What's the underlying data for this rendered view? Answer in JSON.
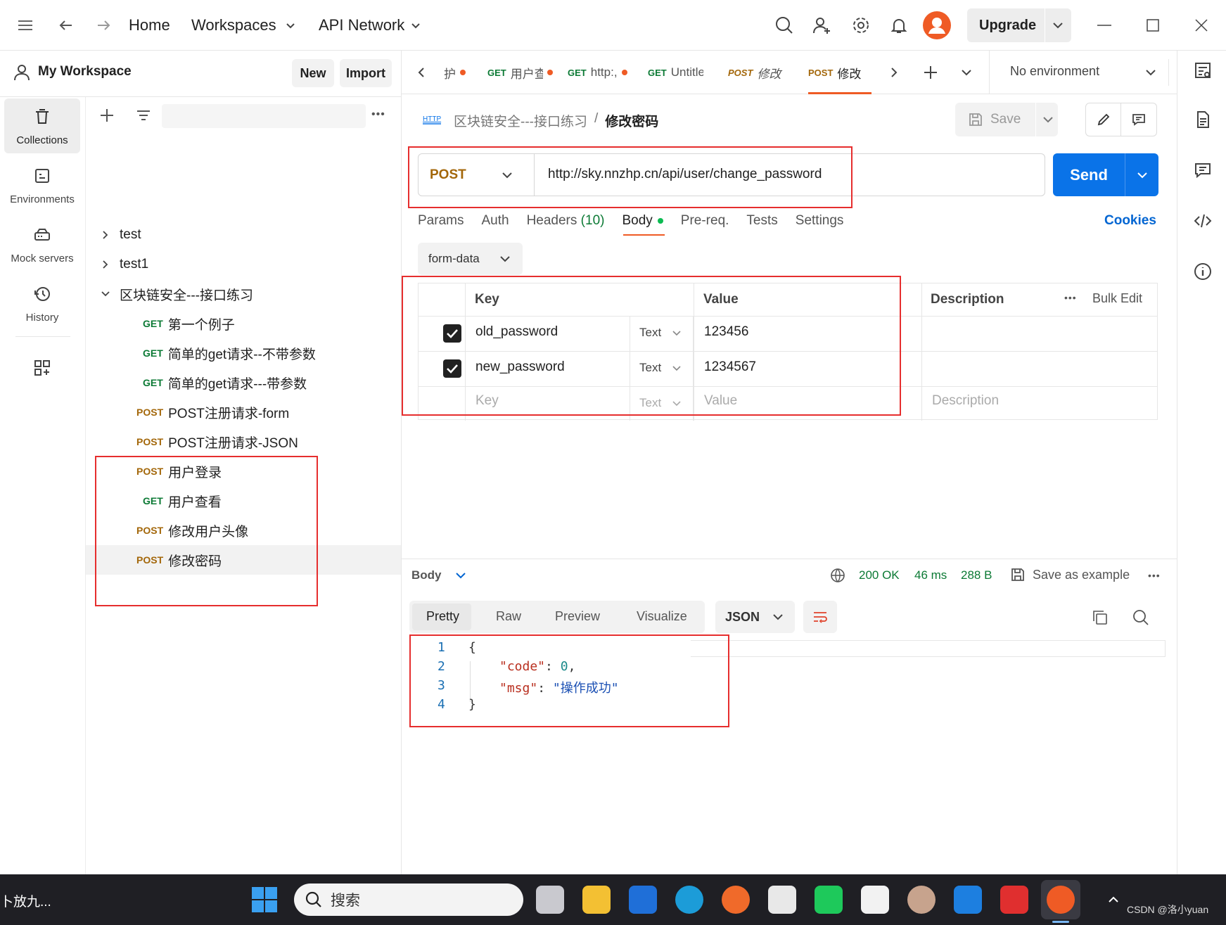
{
  "titlebar": {
    "nav_home": "Home",
    "nav_workspaces": "Workspaces",
    "nav_api_network": "API Network",
    "upgrade_label": "Upgrade"
  },
  "workspace": {
    "name": "My Workspace",
    "new_label": "New",
    "import_label": "Import"
  },
  "leftnav": {
    "items": [
      {
        "label": "Collections"
      },
      {
        "label": "Environments"
      },
      {
        "label": "Mock servers"
      },
      {
        "label": "History"
      }
    ]
  },
  "tree": {
    "items": [
      {
        "method": "",
        "label": "test"
      },
      {
        "method": "",
        "label": "test1"
      },
      {
        "method": "",
        "label": "区块链安全---接口练习"
      },
      {
        "method": "GET",
        "label": "第一个例子"
      },
      {
        "method": "GET",
        "label": "简单的get请求--不带参数"
      },
      {
        "method": "GET",
        "label": "简单的get请求---带参数"
      },
      {
        "method": "POST",
        "label": "POST注册请求-form"
      },
      {
        "method": "POST",
        "label": "POST注册请求-JSON"
      },
      {
        "method": "POST",
        "label": "用户登录"
      },
      {
        "method": "GET",
        "label": "用户查看"
      },
      {
        "method": "POST",
        "label": "修改用户头像"
      },
      {
        "method": "POST",
        "label": "修改密码"
      }
    ]
  },
  "tabs": [
    {
      "method": "",
      "label": "护"
    },
    {
      "method": "GET",
      "label": "用户查"
    },
    {
      "method": "GET",
      "label": "http:,"
    },
    {
      "method": "GET",
      "label": "Untitle"
    },
    {
      "method": "POST",
      "label": "修改"
    },
    {
      "method": "POST",
      "label": "修改"
    }
  ],
  "environment": {
    "label": "No environment"
  },
  "request": {
    "breadcrumb_parent": "区块链安全---接口练习",
    "breadcrumb_sep": "/",
    "breadcrumb_current": "修改密码",
    "save_label": "Save",
    "method": "POST",
    "url": "http://sky.nnzhp.cn/api/user/change_password",
    "send_label": "Send",
    "http_badge": "HTTP"
  },
  "request_tabs": {
    "params": "Params",
    "auth": "Auth",
    "headers": "Headers",
    "headers_count": "(10)",
    "body": "Body",
    "prereq": "Pre-req.",
    "tests": "Tests",
    "settings": "Settings",
    "cookies": "Cookies"
  },
  "body_mode": "form-data",
  "form_table": {
    "col_key": "Key",
    "col_value": "Value",
    "col_description": "Description",
    "bulk_edit": "Bulk Edit",
    "rows": [
      {
        "key": "old_password",
        "type": "Text",
        "value": "123456"
      },
      {
        "key": "new_password",
        "type": "Text",
        "value": "1234567"
      }
    ],
    "placeholder": {
      "key": "Key",
      "type": "Text",
      "value": "Value",
      "description": "Description"
    }
  },
  "response": {
    "body_label": "Body",
    "status": "200 OK",
    "time": "46 ms",
    "size": "288 B",
    "save_example": "Save as example",
    "views": [
      "Pretty",
      "Raw",
      "Preview",
      "Visualize"
    ],
    "format": "JSON",
    "lines": [
      {
        "no": "1",
        "text": "{"
      },
      {
        "no": "2",
        "key": "\"code\"",
        "colon": ": ",
        "num": "0",
        "tail": ","
      },
      {
        "no": "3",
        "key": "\"msg\"",
        "colon": ": ",
        "str": "\"操作成功\""
      },
      {
        "no": "4",
        "text": "}"
      }
    ]
  },
  "taskbar": {
    "left_text": "卜放九...",
    "search_placeholder": "搜索",
    "watermark": "CSDN @洛小yuan"
  },
  "colors": {
    "accent": "#0265d2",
    "send_blue": "#0a73e8",
    "get_green": "#0c7a35",
    "post_orange": "#a3670a",
    "status_green": "#0c7a35",
    "annotation_red": "#e62e2e"
  }
}
